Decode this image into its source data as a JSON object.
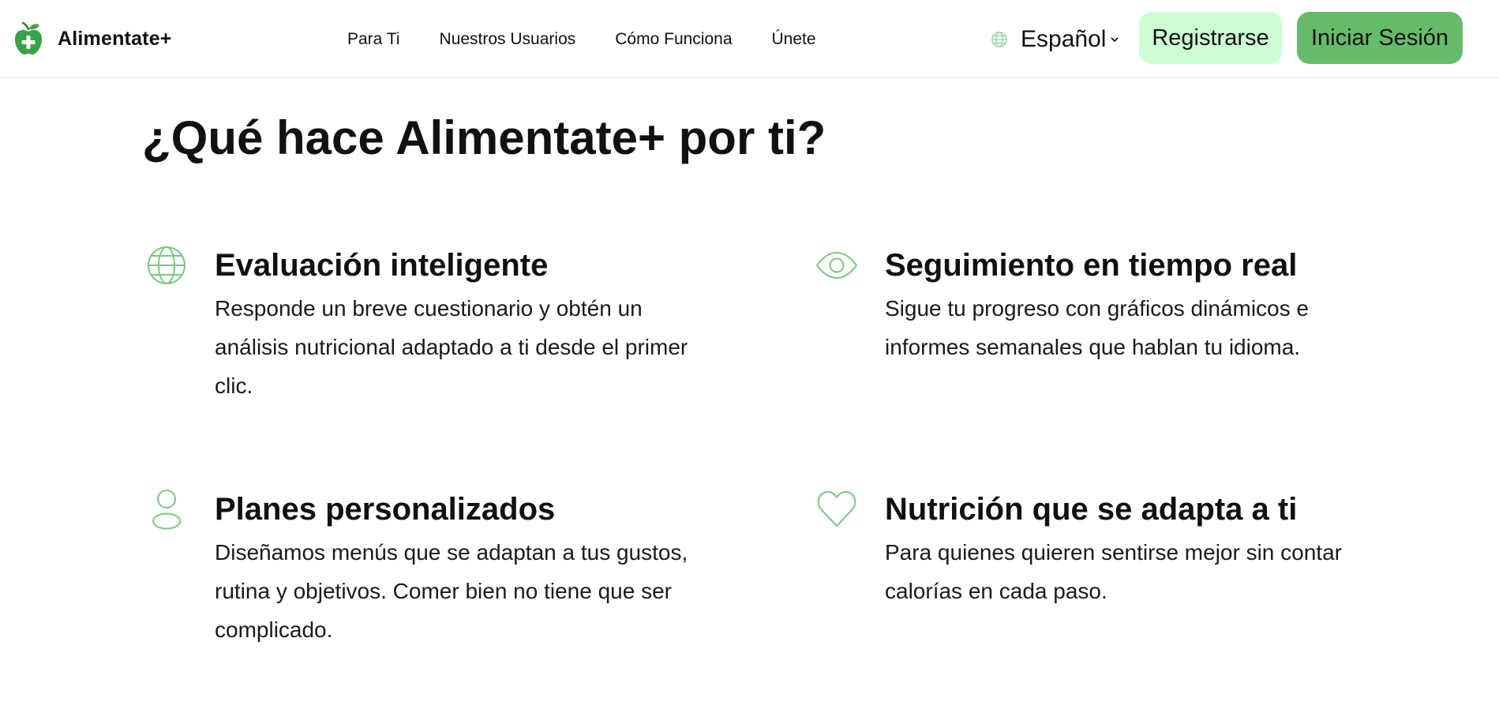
{
  "brand": {
    "name": "Alimentate+",
    "logo_icon": "apple-plus-icon",
    "color": "#3aa34a"
  },
  "nav": {
    "items": [
      {
        "label": "Para Ti"
      },
      {
        "label": "Nuestros Usuarios"
      },
      {
        "label": "Cómo Funciona"
      },
      {
        "label": "Únete"
      }
    ]
  },
  "language": {
    "icon": "globe-icon",
    "selected": "Español",
    "chevron_icon": "chevron-down-icon"
  },
  "actions": {
    "register_label": "Registrarse",
    "login_label": "Iniciar Sesión",
    "register_color": "#ccfdd3",
    "login_color": "#66bb6a"
  },
  "main": {
    "title": "¿Qué hace Alimentate+ por ti?",
    "accent_color": "#7cc784",
    "features": [
      {
        "icon": "globe-icon",
        "title": "Evaluación inteligente",
        "description": "Responde un breve cuestionario y obtén un análisis nutricional adaptado a ti desde el primer clic."
      },
      {
        "icon": "eye-icon",
        "title": "Seguimiento en tiempo real",
        "description": "Sigue tu progreso con gráficos dinámicos e informes semanales que hablan tu idioma."
      },
      {
        "icon": "user-icon",
        "title": "Planes personalizados",
        "description": "Diseñamos menús que se adaptan a tus gustos, rutina y objetivos. Comer bien no tiene que ser complicado."
      },
      {
        "icon": "heart-icon",
        "title": "Nutrición que se adapta a ti",
        "description": "Para quienes quieren sentirse mejor sin contar calorías en cada paso."
      }
    ]
  }
}
